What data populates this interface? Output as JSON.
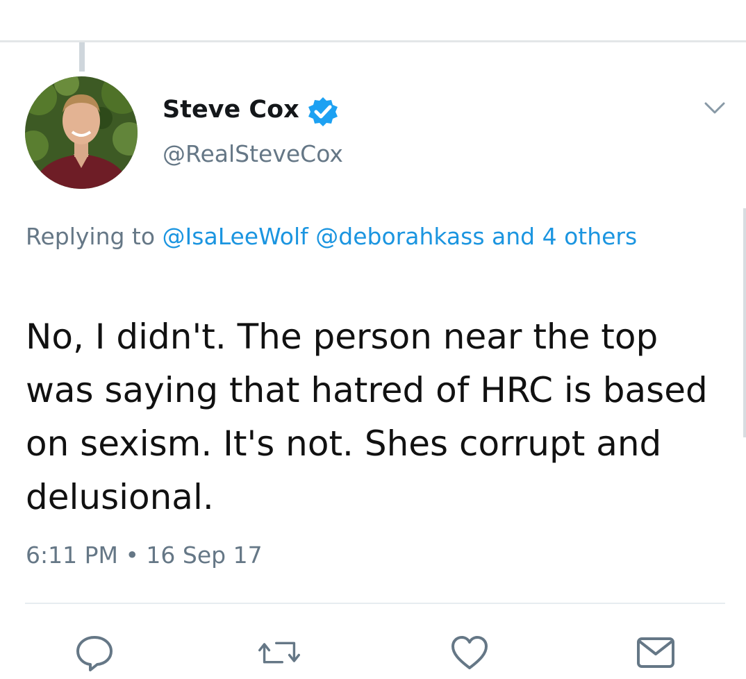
{
  "author": {
    "display_name": "Steve Cox",
    "handle": "@RealSteveCox",
    "verified": true,
    "avatar_icon": "profile-photo"
  },
  "reply_context": {
    "prefix": "Replying to",
    "mentions": [
      "@IsaLeeWolf",
      "@deborahkass"
    ],
    "suffix": "and 4 others"
  },
  "tweet": {
    "text": "No, I didn't. The person near the top was saying that hatred of HRC is based on sexism. It's not. Shes corrupt and delusional.",
    "timestamp": "6:11 PM • 16 Sep 17"
  },
  "actions": [
    {
      "name": "reply",
      "icon": "speech-bubble-icon"
    },
    {
      "name": "retweet",
      "icon": "retweet-icon"
    },
    {
      "name": "like",
      "icon": "heart-icon"
    },
    {
      "name": "direct-message",
      "icon": "envelope-icon"
    }
  ],
  "colors": {
    "link": "#1b95e0",
    "secondary_text": "#657786",
    "icon": "#657786",
    "verified": "#1da1f2"
  }
}
